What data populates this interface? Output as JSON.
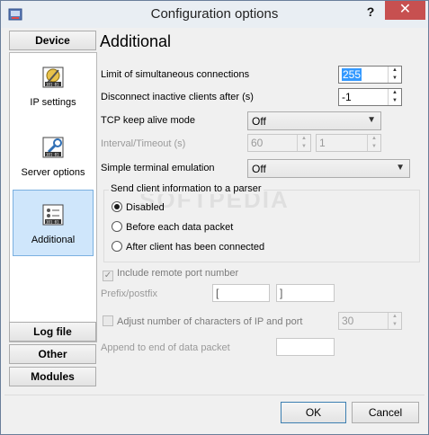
{
  "window": {
    "title": "Configuration options",
    "help_glyph": "?",
    "close_glyph": "✕"
  },
  "nav": {
    "device": "Device",
    "items": [
      {
        "label": "IP settings",
        "icon": "ip-settings-icon"
      },
      {
        "label": "Server options",
        "icon": "server-options-icon"
      },
      {
        "label": "Additional",
        "icon": "additional-icon",
        "selected": true
      }
    ],
    "log_file": "Log file",
    "other": "Other",
    "modules": "Modules"
  },
  "main": {
    "title": "Additional",
    "limit_label": "Limit of simultaneous connections",
    "limit_value": "255",
    "disconnect_label": "Disconnect inactive clients after (s)",
    "disconnect_value": "-1",
    "tcp_label": "TCP keep alive mode",
    "tcp_value": "Off",
    "interval_label": "Interval/Timeout (s)",
    "interval_value": "60",
    "timeout_value": "1",
    "terminal_label": "Simple terminal emulation",
    "terminal_value": "Off",
    "group_label": "Send client information to a parser",
    "radio_disabled": "Disabled",
    "radio_before": "Before each data packet",
    "radio_after": "After client has been connected",
    "include_port": "Include remote port number",
    "prefix_label": "Prefix/postfix",
    "prefix_value": "[",
    "postfix_value": "]",
    "adjust_label": "Adjust number of characters of IP and port",
    "adjust_value": "30",
    "append_label": "Append to end of data packet",
    "append_value": ""
  },
  "watermark": "SOFTPEDIA",
  "buttons": {
    "ok": "OK",
    "cancel": "Cancel"
  },
  "colors": {
    "selection": "#cfe6fb",
    "close": "#c75050"
  }
}
